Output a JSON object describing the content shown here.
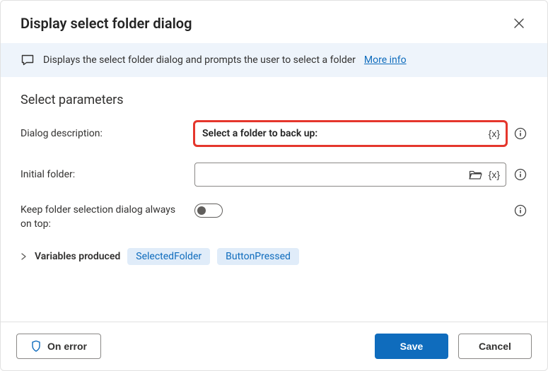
{
  "header": {
    "title": "Display select folder dialog"
  },
  "banner": {
    "text": "Displays the select folder dialog and prompts the user to select a folder",
    "more_info_label": "More info"
  },
  "section": {
    "title": "Select parameters"
  },
  "fields": {
    "dialog_description": {
      "label": "Dialog description:",
      "value": "Select a folder to back up:"
    },
    "initial_folder": {
      "label": "Initial folder:",
      "value": ""
    },
    "keep_on_top": {
      "label": "Keep folder selection dialog always on top:",
      "value": false
    }
  },
  "variables": {
    "label": "Variables produced",
    "items": [
      "SelectedFolder",
      "ButtonPressed"
    ]
  },
  "footer": {
    "on_error_label": "On error",
    "save_label": "Save",
    "cancel_label": "Cancel"
  },
  "glyphs": {
    "xvar": "{x}"
  }
}
